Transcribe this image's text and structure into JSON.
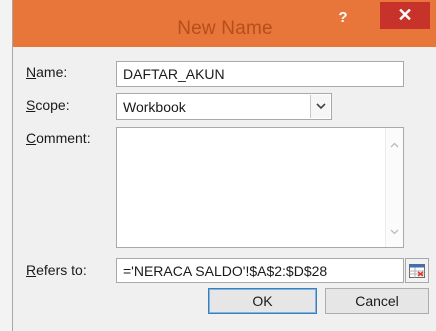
{
  "window": {
    "title": "New Name",
    "help_label": "?",
    "close_label": "✕",
    "accent_color": "#e8763a",
    "close_color": "#c7332b"
  },
  "form": {
    "name_label": "Name:",
    "name_value": "DAFTAR_AKUN",
    "scope_label": "Scope:",
    "scope_value": "Workbook",
    "comment_label": "Comment:",
    "comment_value": "",
    "refers_label": "Refers to:",
    "refers_value": "='NERACA SALDO'!$A$2:$D$28"
  },
  "buttons": {
    "ok_label": "OK",
    "cancel_label": "Cancel"
  },
  "icons": {
    "scope_dropdown": "chevron-down-icon",
    "scroll_up": "scroll-up-icon",
    "scroll_down": "scroll-down-icon",
    "range_picker": "range-select-icon"
  }
}
